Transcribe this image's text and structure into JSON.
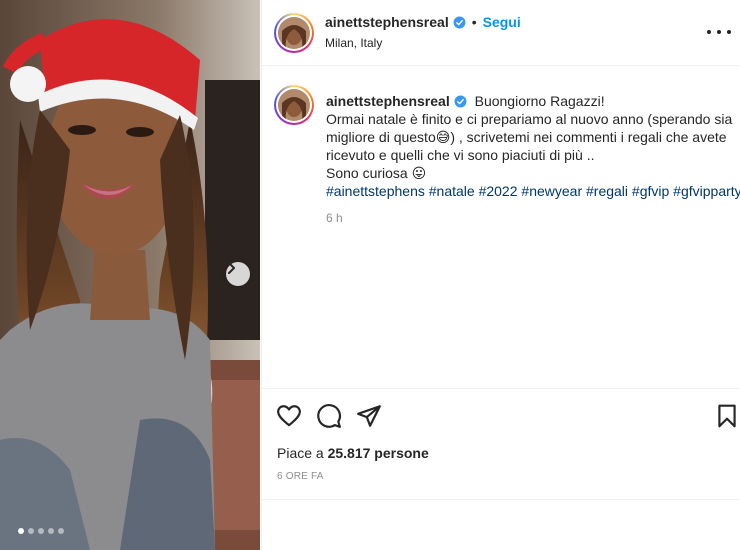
{
  "post": {
    "username": "ainettstephensreal",
    "verified_icon": "verified-badge-icon",
    "follow_label": "Segui",
    "separator": "•",
    "location": "Milan, Italy",
    "more_icon": "more-options-icon"
  },
  "caption": {
    "username": "ainettstephensreal",
    "lines": [
      "Buongiorno Ragazzi!",
      "Ormai natale è finito e ci prepariamo al nuovo anno (sperando sia",
      "migliore di questo😅) , scrivetemi nei commenti i regali che avete",
      "ricevuto e quelli che vi sono piaciuti di più ..",
      "Sono curiosa 😛"
    ],
    "hashtags": [
      "#ainettstephens",
      "#natale",
      "#2022",
      "#newyear",
      "#regali",
      "#gfvip",
      "#gfvipparty"
    ],
    "time": "6 h"
  },
  "actions": {
    "like_icon": "heart-icon",
    "comment_icon": "comment-icon",
    "share_icon": "share-icon",
    "save_icon": "bookmark-icon"
  },
  "likes_text": "Piace a 25.817 persone",
  "date_text": "6 ORE FA",
  "carousel": {
    "current": 1,
    "total": 5,
    "next_icon": "chevron-right-icon"
  },
  "colors": {
    "link_blue": "#0095f6",
    "hashtag_blue": "#00376b",
    "verified_blue": "#3897f0"
  }
}
